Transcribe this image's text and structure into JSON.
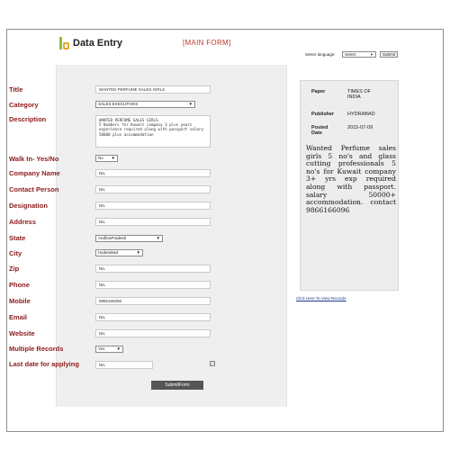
{
  "header": {
    "app_title": "Data Entry",
    "main_form_label": "[MAIN FORM]",
    "language_label": "Select language:",
    "language_selected": "Select",
    "submit_label": "Submit"
  },
  "form": {
    "fields": [
      {
        "label": "Title",
        "value": "WANTED PERFUME SALES GIRLS",
        "kind": "text"
      },
      {
        "label": "Category",
        "value": "SALES EXECUTIVES",
        "kind": "select"
      },
      {
        "label": "Description",
        "value": "WANTED PERFUME SALES GIRLS.\n5 Numbers for Kuwait company 3 plus years experience required along with passport salary 50000 plus accommodation",
        "kind": "textarea"
      },
      {
        "label": "Walk In- Yes/No",
        "value": "No",
        "kind": "select"
      },
      {
        "label": "Company Name",
        "value": "NIL",
        "kind": "text"
      },
      {
        "label": "Contact Person",
        "value": "NIL",
        "kind": "text"
      },
      {
        "label": "Designation",
        "value": "NIL",
        "kind": "text"
      },
      {
        "label": "Address",
        "value": "NIL",
        "kind": "text"
      },
      {
        "label": "State",
        "value": "AndhraPradesh",
        "kind": "select"
      },
      {
        "label": "City",
        "value": "Hyderabad",
        "kind": "select"
      },
      {
        "label": "Zip",
        "value": "NIL",
        "kind": "text"
      },
      {
        "label": "Phone",
        "value": "NIL",
        "kind": "text"
      },
      {
        "label": "Mobile",
        "value": "9866166096",
        "kind": "text"
      },
      {
        "label": "Email",
        "value": "NIL",
        "kind": "text"
      },
      {
        "label": "Website",
        "value": "NIL",
        "kind": "text"
      },
      {
        "label": "Multiple Records",
        "value": "Yes",
        "kind": "select"
      },
      {
        "label": "Last date for applying",
        "value": "NIL",
        "kind": "date"
      }
    ],
    "submit_label": "SubmitForm"
  },
  "side": {
    "paper_label": "Paper",
    "paper_value": "TIMES OF INDIA",
    "publisher_label": "Publisher",
    "publisher_value": "HYDRABAD",
    "posted_label": "Posted Date",
    "posted_value": "2015-07-09",
    "ad_text": "Wanted Perfume sales girls 5 no's and glass cutting professionals 5 no's for Kuwait company 3+ yrs exp required along with passport. salary 50000+ accommodation. contact 9866166096",
    "records_link": "Click Here To View Records"
  }
}
